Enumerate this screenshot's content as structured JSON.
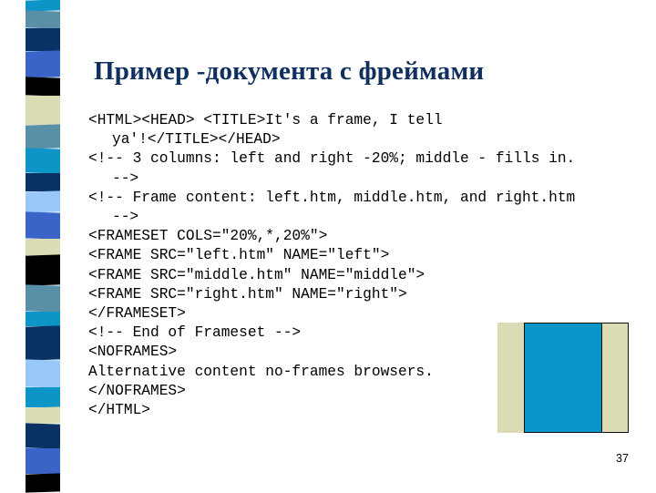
{
  "slide": {
    "title": "Пример -документа с фреймами",
    "page_number": "37"
  },
  "code_lines": [
    {
      "text": "<HTML><HEAD> <TITLE>It's a frame, I tell",
      "indent": false
    },
    {
      "text": "ya'!</TITLE></HEAD>",
      "indent": true
    },
    {
      "text": "<!-- 3 columns: left and right -20%; middle - fills in.",
      "indent": false
    },
    {
      "text": "-->",
      "indent": true
    },
    {
      "text": "<!-- Frame content: left.htm, middle.htm, and right.htm",
      "indent": false
    },
    {
      "text": "-->",
      "indent": true
    },
    {
      "text": "<FRAMESET COLS=\"20%,*,20%\">",
      "indent": false
    },
    {
      "text": "<FRAME SRC=\"left.htm\" NAME=\"left\">",
      "indent": false
    },
    {
      "text": "<FRAME SRC=\"middle.htm\" NAME=\"middle\">",
      "indent": false
    },
    {
      "text": "<FRAME SRC=\"right.htm\" NAME=\"right\">",
      "indent": false
    },
    {
      "text": "</FRAMESET>",
      "indent": false
    },
    {
      "text": "<!-- End of Frameset -->",
      "indent": false
    },
    {
      "text": "<NOFRAMES>",
      "indent": false
    },
    {
      "text": "Alternative content no-frames browsers.",
      "indent": false
    },
    {
      "text": "</NOFRAMES>",
      "indent": false
    },
    {
      "text": "</HTML>",
      "indent": false
    }
  ],
  "frame_diagram": {
    "columns": [
      {
        "name": "left",
        "share_percent": 20,
        "color": "#dcdcb4"
      },
      {
        "name": "middle",
        "share_percent": 60,
        "color": "#0995c8"
      },
      {
        "name": "right",
        "share_percent": 20,
        "color": "#dcdcb4"
      }
    ]
  },
  "colors": {
    "title": "#0f2f5f",
    "stripes": [
      "#0d95c8",
      "#5a8fa8",
      "#0a3264",
      "#3a64c8",
      "#000000",
      "#dcdcb4",
      "#5a8fa8",
      "#0d95c8",
      "#0a3264",
      "#99c8f8",
      "#3a64c8",
      "#dcdcb4",
      "#000000",
      "#5a8fa8",
      "#0d95c8",
      "#0a3264",
      "#99c8f8",
      "#0d95c8",
      "#dcdcb4",
      "#0a3264",
      "#3a64c8",
      "#000000"
    ]
  }
}
